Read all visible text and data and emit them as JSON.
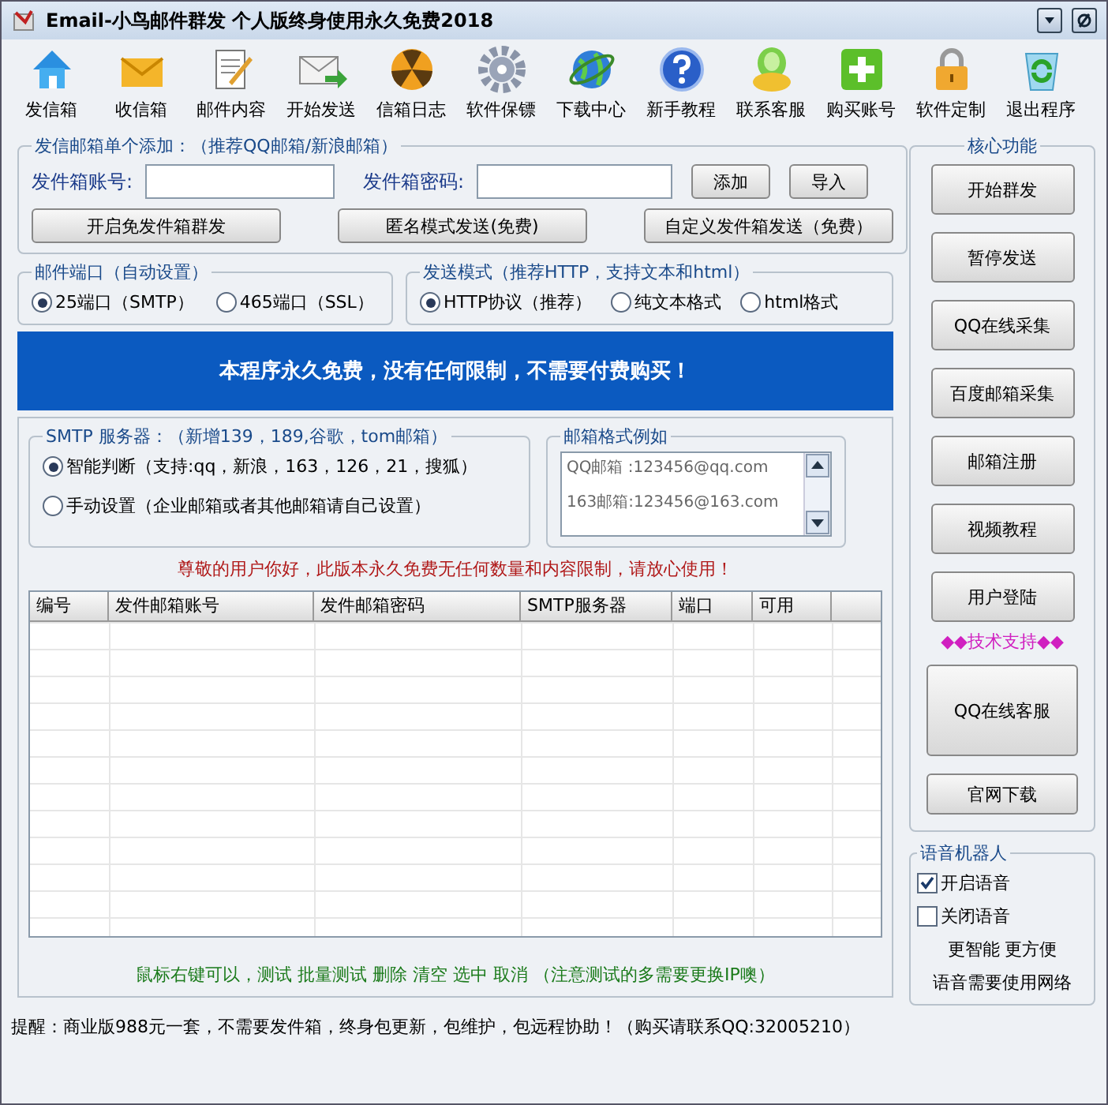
{
  "window": {
    "title": "Email-小鸟邮件群发 个人版终身使用永久免费2018"
  },
  "toolbar": [
    {
      "label": "发信箱"
    },
    {
      "label": "收信箱"
    },
    {
      "label": "邮件内容"
    },
    {
      "label": "开始发送"
    },
    {
      "label": "信箱日志"
    },
    {
      "label": "软件保镖"
    },
    {
      "label": "下载中心"
    },
    {
      "label": "新手教程"
    },
    {
      "label": "联系客服"
    },
    {
      "label": "购买账号"
    },
    {
      "label": "软件定制"
    },
    {
      "label": "退出程序"
    }
  ],
  "sender_group": {
    "title": "发信邮箱单个添加：（推荐QQ邮箱/新浪邮箱）",
    "account_label": "发件箱账号:",
    "password_label": "发件箱密码:",
    "buttons": [
      "添加",
      "导入"
    ],
    "mode_buttons": [
      "开启免发件箱群发",
      "匿名模式发送(免费)",
      "自定义发件箱发送（免费）"
    ]
  },
  "port_group": {
    "title": "邮件端口（自动设置）",
    "options": [
      {
        "label": "25端口（SMTP）",
        "selected": true
      },
      {
        "label": "465端口（SSL）",
        "selected": false
      }
    ]
  },
  "send_mode_group": {
    "title": "发送模式（推荐HTTP，支持文本和html）",
    "options": [
      {
        "label": "HTTP协议（推荐）",
        "selected": true
      },
      {
        "label": "纯文本格式",
        "selected": false
      },
      {
        "label": "html格式",
        "selected": false
      }
    ]
  },
  "banner": "本程序永久免费，没有任何限制，不需要付费购买！",
  "smtp_group": {
    "title": "SMTP 服务器：（新增139，189,谷歌，tom邮箱）",
    "options": [
      {
        "label": "智能判断（支持:qq，新浪，163，126，21，搜狐）",
        "selected": true
      },
      {
        "label": "手动设置（企业邮箱或者其他邮箱请自己设置）",
        "selected": false
      }
    ]
  },
  "format_group": {
    "title": "邮箱格式例如",
    "lines": [
      "QQ邮箱 :123456@qq.com",
      "163邮箱:123456@163.com"
    ]
  },
  "notice": "尊敬的用户你好，此版本永久免费无任何数量和内容限制，请放心使用！",
  "table": {
    "columns": [
      "编号",
      "发件邮箱账号",
      "发件邮箱密码",
      "SMTP服务器",
      "端口",
      "可用"
    ]
  },
  "hint": "鼠标右键可以，测试 批量测试 删除 清空 选中 取消 （注意测试的多需要更换IP噢）",
  "core_group": {
    "title": "核心功能",
    "buttons": [
      "开始群发",
      "暂停发送",
      "QQ在线采集",
      "百度邮箱采集",
      "邮箱注册",
      "视频教程",
      "用户登陆"
    ],
    "support_label": "◆◆技术支持◆◆",
    "support_button": "QQ在线客服",
    "download_button": "官网下载"
  },
  "voice_group": {
    "title": "语音机器人",
    "options": [
      {
        "label": "开启语音",
        "checked": true
      },
      {
        "label": "关闭语音",
        "checked": false
      }
    ],
    "lines": [
      "更智能 更方便",
      "语音需要使用网络"
    ]
  },
  "status_bar": "提醒：商业版988元一套，不需要发件箱，终身包更新，包维护，包远程协助！（购买请联系QQ:32005210）"
}
